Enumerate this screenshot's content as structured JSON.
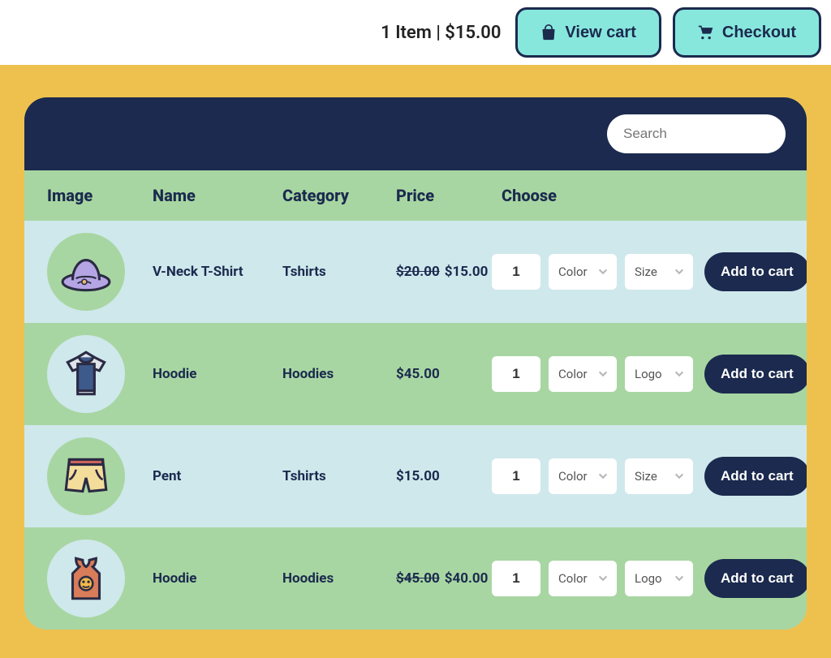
{
  "top": {
    "summary": "1 Item | $15.00",
    "view_cart_label": "View cart",
    "checkout_label": "Checkout"
  },
  "search": {
    "placeholder": "Search"
  },
  "columns": {
    "image": "Image",
    "name": "Name",
    "category": "Category",
    "price": "Price",
    "choose": "Choose"
  },
  "add_to_cart_label": "Add to cart",
  "default_qty": "1",
  "products": [
    {
      "icon": "hat-icon",
      "name": "V-Neck T-Shirt",
      "category": "Tshirts",
      "old_price": "$20.00",
      "price": "$15.00",
      "opt1": "Color",
      "opt2": "Size"
    },
    {
      "icon": "tshirt-icon",
      "name": "Hoodie",
      "category": "Hoodies",
      "old_price": "",
      "price": "$45.00",
      "opt1": "Color",
      "opt2": "Logo"
    },
    {
      "icon": "shorts-icon",
      "name": "Pent",
      "category": "Tshirts",
      "old_price": "",
      "price": "$15.00",
      "opt1": "Color",
      "opt2": "Size"
    },
    {
      "icon": "tank-icon",
      "name": "Hoodie",
      "category": "Hoodies",
      "old_price": "$45.00",
      "price": "$40.00",
      "opt1": "Color",
      "opt2": "Logo"
    }
  ]
}
